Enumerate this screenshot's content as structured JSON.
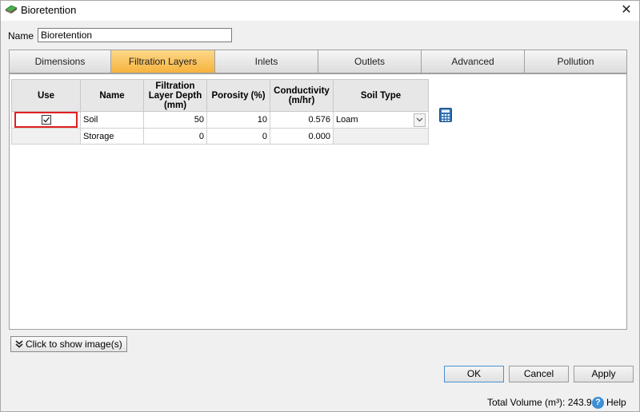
{
  "window": {
    "title": "Bioretention",
    "icon": "bioretention-icon",
    "close_glyph": "✕"
  },
  "name_field": {
    "label": "Name",
    "value": "Bioretention"
  },
  "tabs": [
    {
      "label": "Dimensions",
      "active": false
    },
    {
      "label": "Filtration Layers",
      "active": true
    },
    {
      "label": "Inlets",
      "active": false
    },
    {
      "label": "Outlets",
      "active": false
    },
    {
      "label": "Advanced",
      "active": false
    },
    {
      "label": "Pollution",
      "active": false
    }
  ],
  "table": {
    "headers": {
      "use": "Use",
      "name": "Name",
      "depth": "Filtration Layer Depth (mm)",
      "porosity": "Porosity (%)",
      "conductivity": "Conductivity (m/hr)",
      "soil_type": "Soil Type"
    },
    "rows": [
      {
        "use": true,
        "name": "Soil",
        "depth": "50",
        "porosity": "10",
        "conductivity": "0.576",
        "soil_type": "Loam"
      },
      {
        "use": null,
        "name": "Storage",
        "depth": "0",
        "porosity": "0",
        "conductivity": "0.000",
        "soil_type": ""
      }
    ]
  },
  "show_images": {
    "label": "Click to show image(s)",
    "icon": "double-chevron-down-icon"
  },
  "buttons": {
    "ok": "OK",
    "cancel": "Cancel",
    "apply": "Apply"
  },
  "status": {
    "total_volume": "Total Volume (m³): 243.911",
    "help": "Help"
  },
  "colors": {
    "active_tab": "#f6b33d",
    "selection_border": "#e02020",
    "help_icon": "#3a8fd6"
  }
}
